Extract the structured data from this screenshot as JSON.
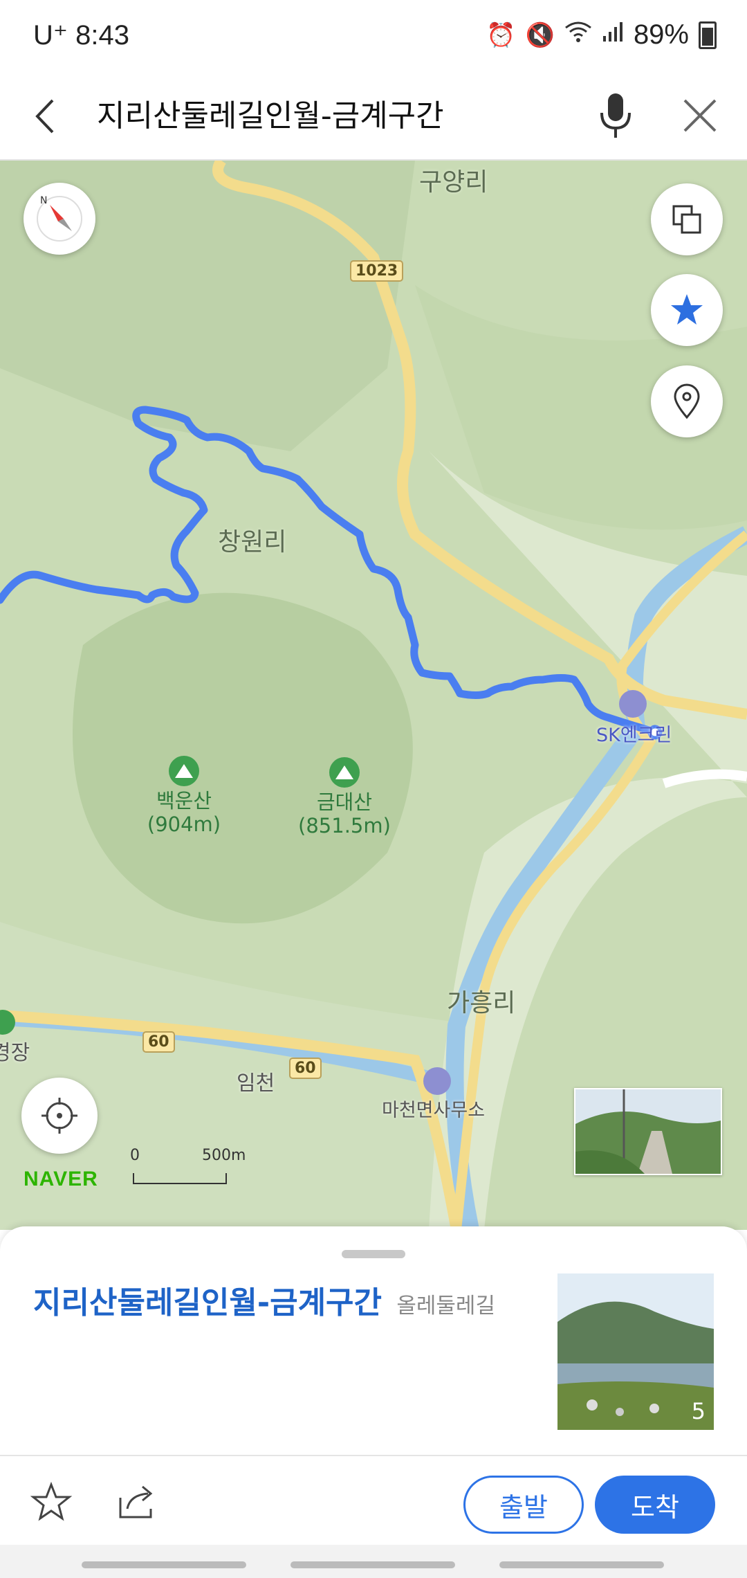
{
  "status_bar": {
    "carrier": "U⁺ 8:43",
    "battery": "89%"
  },
  "search": {
    "query": "지리산둘레길인월-금계구간"
  },
  "map": {
    "labels": {
      "village_top": "구양리",
      "village_mid": "창원리",
      "village_east": "가흥리",
      "imcheon": "임천",
      "left_edge": "경장"
    },
    "road_shields": {
      "r1023": "1023",
      "r60a": "60",
      "r60b": "60"
    },
    "pois": {
      "gas_station": "SK엔크린",
      "office": "마천면사무소"
    },
    "mountains": [
      {
        "name": "백운산",
        "height": "(904m)"
      },
      {
        "name": "금대산",
        "height": "(851.5m)"
      }
    ],
    "scale": {
      "start": "0",
      "end": "500m"
    },
    "logo": "NAVER",
    "route_color": "#4a7ef0"
  },
  "place": {
    "title": "지리산둘레길인월-금계구간",
    "category": "올레둘레길",
    "photo_count": "5"
  },
  "actions": {
    "depart": "출발",
    "arrive": "도착"
  }
}
